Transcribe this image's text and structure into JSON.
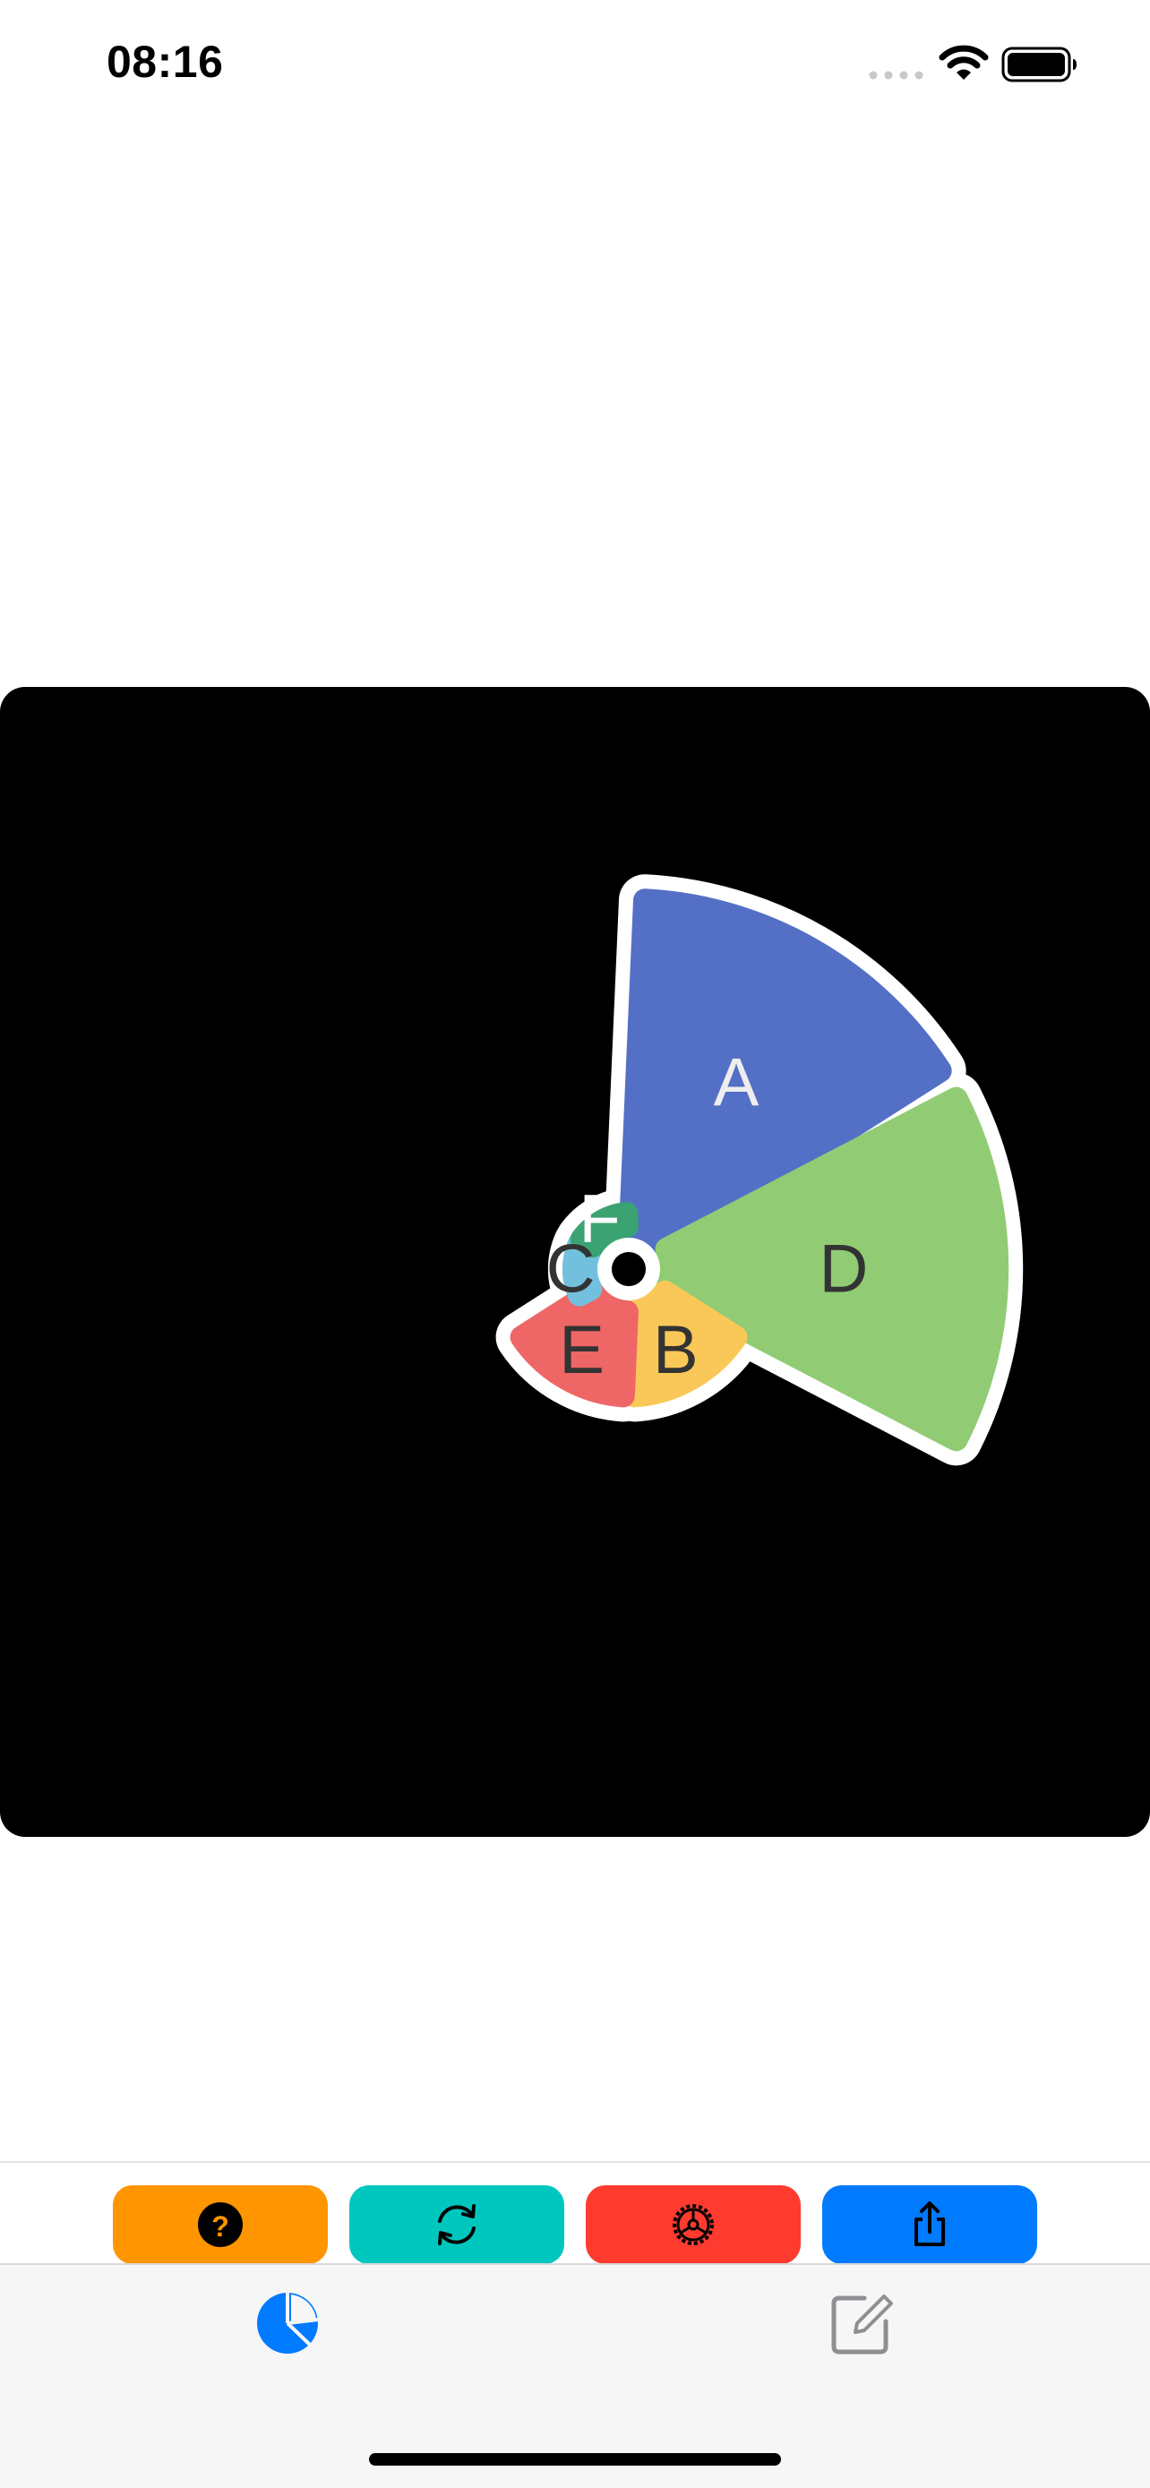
{
  "status_bar": {
    "time": "08:16",
    "icons": [
      "signal-dots-icon",
      "wifi-icon",
      "battery-icon"
    ]
  },
  "chart_data": {
    "type": "pie",
    "variant": "rounded-rose",
    "background": "#000000",
    "outline_color": "#ffffff",
    "slices": [
      {
        "label": "A",
        "color": "#5470C6",
        "label_color": "#eeeeee",
        "angle_start": 0,
        "angle_end": 60,
        "radius": 100
      },
      {
        "label": "D",
        "color": "#91CC75",
        "label_color": "#333333",
        "angle_start": 60,
        "angle_end": 120,
        "radius": 100
      },
      {
        "label": "B",
        "color": "#FAC858",
        "label_color": "#333333",
        "angle_start": 120,
        "angle_end": 180,
        "radius": 32
      },
      {
        "label": "E",
        "color": "#EE6666",
        "label_color": "#333333",
        "angle_start": 180,
        "angle_end": 240,
        "radius": 32
      },
      {
        "label": "C",
        "color": "#73C0DE",
        "label_color": "#333333",
        "angle_start": 240,
        "angle_end": 300,
        "radius": 12
      },
      {
        "label": "F",
        "color": "#3BA272",
        "label_color": "#ffffff",
        "angle_start": 300,
        "angle_end": 360,
        "radius": 12
      }
    ]
  },
  "toolbar": {
    "buttons": [
      {
        "name": "help-button",
        "icon": "question-icon",
        "color": "#FF9500"
      },
      {
        "name": "refresh-button",
        "icon": "refresh-icon",
        "color": "#00C7BE"
      },
      {
        "name": "settings-button",
        "icon": "gear-icon",
        "color": "#FF3B30"
      },
      {
        "name": "share-button",
        "icon": "share-icon",
        "color": "#007AFF"
      }
    ]
  },
  "tabbar": {
    "tabs": [
      {
        "name": "tab-chart",
        "icon": "pie-chart-icon",
        "selected": true,
        "color": "#007AFF"
      },
      {
        "name": "tab-edit",
        "icon": "edit-icon",
        "selected": false,
        "color": "#8e8e93"
      }
    ]
  }
}
